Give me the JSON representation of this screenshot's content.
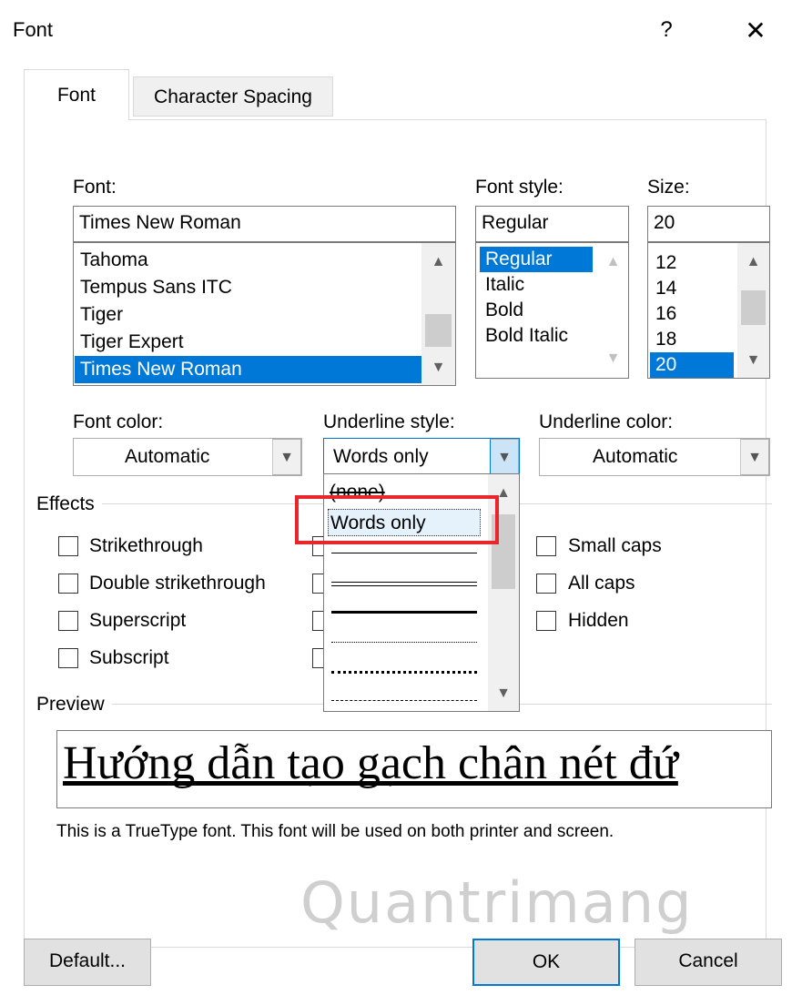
{
  "dialog": {
    "title": "Font",
    "help_label": "?",
    "close_label": "✕"
  },
  "tabs": [
    {
      "label": "Font"
    },
    {
      "label": "Character Spacing"
    }
  ],
  "font_section": {
    "font_label": "Font:",
    "font_value": "Times New Roman",
    "font_list": [
      "Tahoma",
      "Tempus Sans ITC",
      "Tiger",
      "Tiger Expert",
      "Times New Roman"
    ],
    "selected_font": "Times New Roman",
    "style_label": "Font style:",
    "style_value": "Regular",
    "style_list": [
      "Regular",
      "Italic",
      "Bold",
      "Bold Italic"
    ],
    "selected_style": "Regular",
    "size_label": "Size:",
    "size_value": "20",
    "size_list": [
      "12",
      "14",
      "16",
      "18",
      "20"
    ],
    "selected_size": "20"
  },
  "color_row": {
    "font_color_label": "Font color:",
    "font_color_value": "Automatic",
    "underline_style_label": "Underline style:",
    "underline_style_value": "Words only",
    "underline_color_label": "Underline color:",
    "underline_color_value": "Automatic"
  },
  "underline_dropdown": {
    "items": [
      "(none)",
      "Words only"
    ],
    "selected": "Words only",
    "line_styles": [
      "single",
      "double",
      "thick",
      "dotted",
      "thick-dotted",
      "dashed"
    ]
  },
  "effects": {
    "header": "Effects",
    "left": [
      "Strikethrough",
      "Double strikethrough",
      "Superscript",
      "Subscript"
    ],
    "right": [
      "Small caps",
      "All caps",
      "Hidden"
    ]
  },
  "preview": {
    "header": "Preview",
    "sample": "Hướng dẫn tạo gạch chân nét đứ",
    "note": "This is a TrueType font. This font will be used on both printer and screen."
  },
  "buttons": {
    "default": "Default...",
    "ok": "OK",
    "cancel": "Cancel"
  },
  "watermark": "Quantrimang",
  "colors": {
    "selection": "#0078d7",
    "highlight_box": "#e8262b"
  },
  "icons": {
    "up": "chevron-up-icon",
    "down": "chevron-down-icon"
  }
}
